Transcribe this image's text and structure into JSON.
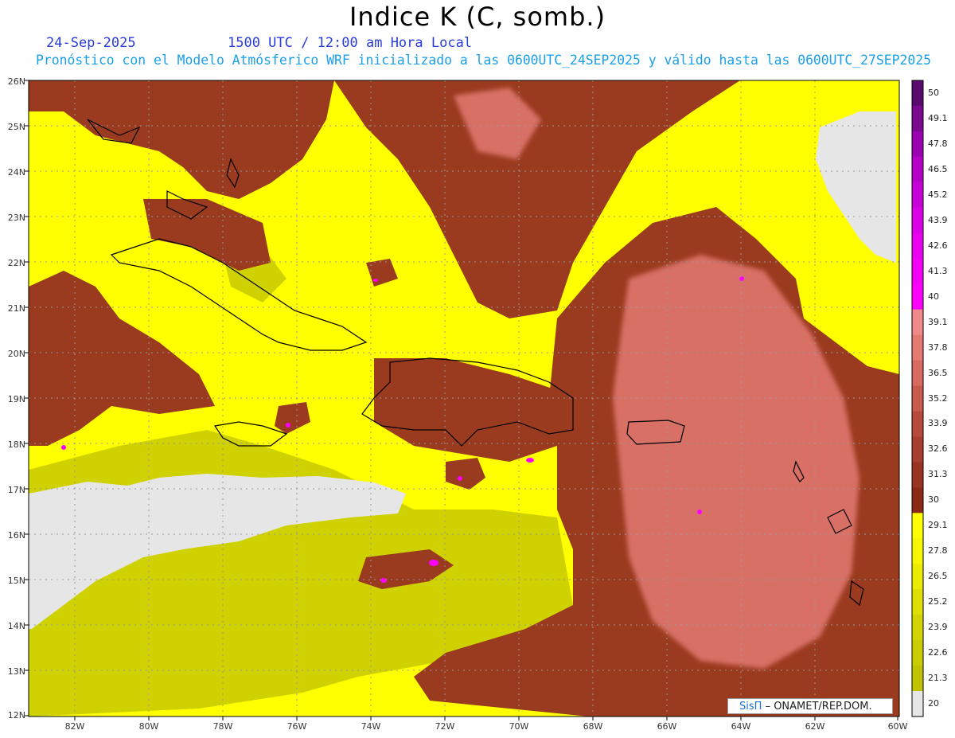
{
  "header": {
    "title": "Indice K (C, somb.)",
    "date": "24-Sep-2025",
    "time": "1500 UTC / 12:00 am Hora Local",
    "info": "Pronóstico con el Modelo Atmósferico WRF inicializado a las 0600UTC_24SEP2025 y válido hasta las  0600UTC_27SEP2025"
  },
  "axes": {
    "lat_labels": [
      "26N",
      "25N",
      "24N",
      "23N",
      "22N",
      "21N",
      "20N",
      "19N",
      "18N",
      "17N",
      "16N",
      "15N",
      "14N",
      "13N",
      "12N"
    ],
    "lon_labels": [
      "82W",
      "80W",
      "78W",
      "76W",
      "74W",
      "72W",
      "70W",
      "68W",
      "66W",
      "64W",
      "62W",
      "60W"
    ]
  },
  "colorbar": {
    "labels": [
      "50",
      "49.1",
      "47.8",
      "46.5",
      "45.2",
      "43.9",
      "42.6",
      "41.3",
      "40",
      "39.1",
      "37.8",
      "36.5",
      "35.2",
      "33.9",
      "32.6",
      "31.3",
      "30",
      "29.1",
      "27.8",
      "26.5",
      "25.2",
      "23.9",
      "22.6",
      "21.3",
      "20"
    ],
    "colors": [
      "#5a0a6e",
      "#7a0890",
      "#9a00b0",
      "#b400c8",
      "#c800d8",
      "#dc00e6",
      "#ea00ee",
      "#f400f4",
      "#ff00ff",
      "#f08a8a",
      "#e47a72",
      "#d86a60",
      "#c95a4e",
      "#b84a3c",
      "#a83e2e",
      "#983420",
      "#8a2a14",
      "#ffff00",
      "#f6f600",
      "#eaec00",
      "#dede00",
      "#d2d400",
      "#c8cc00",
      "#c0c400",
      "#e6e6e6"
    ]
  },
  "credit": {
    "logo": "SisΠ",
    "text": "– ONAMET/REP.DOM."
  },
  "colors": {
    "low": "#e6e6e6",
    "yellow": "#ffff00",
    "olive": "#cfd200",
    "brown": "#9a3a1e",
    "rose": "#d87066",
    "magenta": "#ff00ff"
  }
}
